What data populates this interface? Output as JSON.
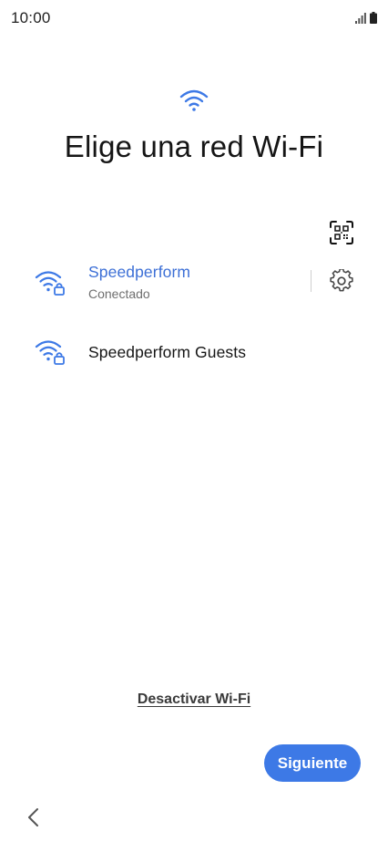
{
  "status_bar": {
    "time": "10:00",
    "icons": [
      "signal-icon",
      "battery-icon"
    ]
  },
  "header": {
    "icon": "wifi-icon",
    "title": "Elige una red Wi-Fi"
  },
  "qr_scan": {
    "icon": "qr-code-scan-icon"
  },
  "networks": [
    {
      "name": "Speedperform",
      "status": "Conectado",
      "icon": "wifi-lock-icon",
      "connected": true,
      "settings_icon": "gear-icon"
    },
    {
      "name": "Speedperform Guests",
      "status": "",
      "icon": "wifi-lock-icon",
      "connected": false
    }
  ],
  "actions": {
    "disable_wifi_label": "Desactivar Wi-Fi",
    "next_label": "Siguiente"
  },
  "navigation": {
    "back_icon": "chevron-left-icon"
  },
  "colors": {
    "accent": "#3d79e6",
    "connected_text": "#3c6fd6",
    "secondary_text": "#6f6f6f",
    "title_text": "#151515"
  }
}
